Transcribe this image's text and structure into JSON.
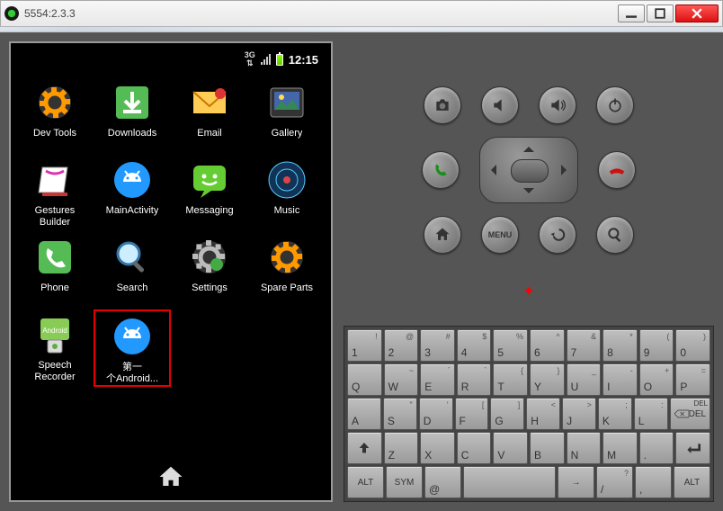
{
  "window": {
    "title": "5554:2.3.3"
  },
  "statusbar": {
    "time": "12:15"
  },
  "apps": [
    {
      "name": "dev-tools",
      "label": "Dev Tools",
      "icon": "gear-orange"
    },
    {
      "name": "downloads",
      "label": "Downloads",
      "icon": "download-green"
    },
    {
      "name": "email",
      "label": "Email",
      "icon": "envelope-orange"
    },
    {
      "name": "gallery",
      "label": "Gallery",
      "icon": "picture"
    },
    {
      "name": "gestures-builder",
      "label": "Gestures\nBuilder",
      "icon": "notebook"
    },
    {
      "name": "main-activity",
      "label": "MainActivity",
      "icon": "android-head-blue"
    },
    {
      "name": "messaging",
      "label": "Messaging",
      "icon": "smile-green"
    },
    {
      "name": "music",
      "label": "Music",
      "icon": "music-disc"
    },
    {
      "name": "phone",
      "label": "Phone",
      "icon": "phone-green"
    },
    {
      "name": "search",
      "label": "Search",
      "icon": "magnifier"
    },
    {
      "name": "settings",
      "label": "Settings",
      "icon": "gear-grey"
    },
    {
      "name": "spare-parts",
      "label": "Spare Parts",
      "icon": "gear-orange"
    },
    {
      "name": "speech-recorder",
      "label": "Speech\nRecorder",
      "icon": "android-box"
    },
    {
      "name": "first-android",
      "label": "第一\n个Android...",
      "icon": "android-head-blue",
      "highlighted": true
    }
  ],
  "keyboard": [
    [
      {
        "m": "1",
        "s": "!"
      },
      {
        "m": "2",
        "s": "@"
      },
      {
        "m": "3",
        "s": "#"
      },
      {
        "m": "4",
        "s": "$"
      },
      {
        "m": "5",
        "s": "%"
      },
      {
        "m": "6",
        "s": "^"
      },
      {
        "m": "7",
        "s": "&"
      },
      {
        "m": "8",
        "s": "*"
      },
      {
        "m": "9",
        "s": "("
      },
      {
        "m": "0",
        "s": ")"
      }
    ],
    [
      {
        "m": "Q",
        "s": ""
      },
      {
        "m": "W",
        "s": "~"
      },
      {
        "m": "E",
        "s": "´"
      },
      {
        "m": "R",
        "s": "`"
      },
      {
        "m": "T",
        "s": "{"
      },
      {
        "m": "Y",
        "s": "}"
      },
      {
        "m": "U",
        "s": "_"
      },
      {
        "m": "I",
        "s": "-"
      },
      {
        "m": "O",
        "s": "+"
      },
      {
        "m": "P",
        "s": "="
      }
    ],
    [
      {
        "m": "A",
        "s": ""
      },
      {
        "m": "S",
        "s": "\""
      },
      {
        "m": "D",
        "s": "'"
      },
      {
        "m": "F",
        "s": "["
      },
      {
        "m": "G",
        "s": "]"
      },
      {
        "m": "H",
        "s": "<"
      },
      {
        "m": "J",
        "s": ">"
      },
      {
        "m": "K",
        "s": ";"
      },
      {
        "m": "L",
        "s": ":"
      },
      {
        "m": "DEL",
        "s": "",
        "icon": "del",
        "special": true
      }
    ],
    [
      {
        "m": "",
        "icon": "shift",
        "special": true
      },
      {
        "m": "Z",
        "s": ""
      },
      {
        "m": "X",
        "s": ""
      },
      {
        "m": "C",
        "s": ""
      },
      {
        "m": "V",
        "s": ""
      },
      {
        "m": "B",
        "s": ""
      },
      {
        "m": "N",
        "s": ""
      },
      {
        "m": "M",
        "s": ""
      },
      {
        "m": ".",
        "s": ""
      },
      {
        "m": "",
        "icon": "enter",
        "special": true
      }
    ],
    [
      {
        "m": "ALT",
        "special": true
      },
      {
        "m": "SYM",
        "special": true
      },
      {
        "m": "@",
        "s": ""
      },
      {
        "m": "",
        "s": "",
        "wide": true,
        "span": 3
      },
      {
        "m": "→",
        "s": "",
        "special": true
      },
      {
        "m": "/",
        "s": "?"
      },
      {
        "m": ",",
        "s": ""
      },
      {
        "m": "ALT",
        "special": true
      }
    ]
  ],
  "controls": {
    "row1": [
      "camera",
      "vol-down",
      "vol-up",
      "power"
    ],
    "row2": [
      "call",
      "dpad",
      "end-call"
    ],
    "row3": [
      "home",
      "menu",
      "back",
      "search"
    ]
  }
}
